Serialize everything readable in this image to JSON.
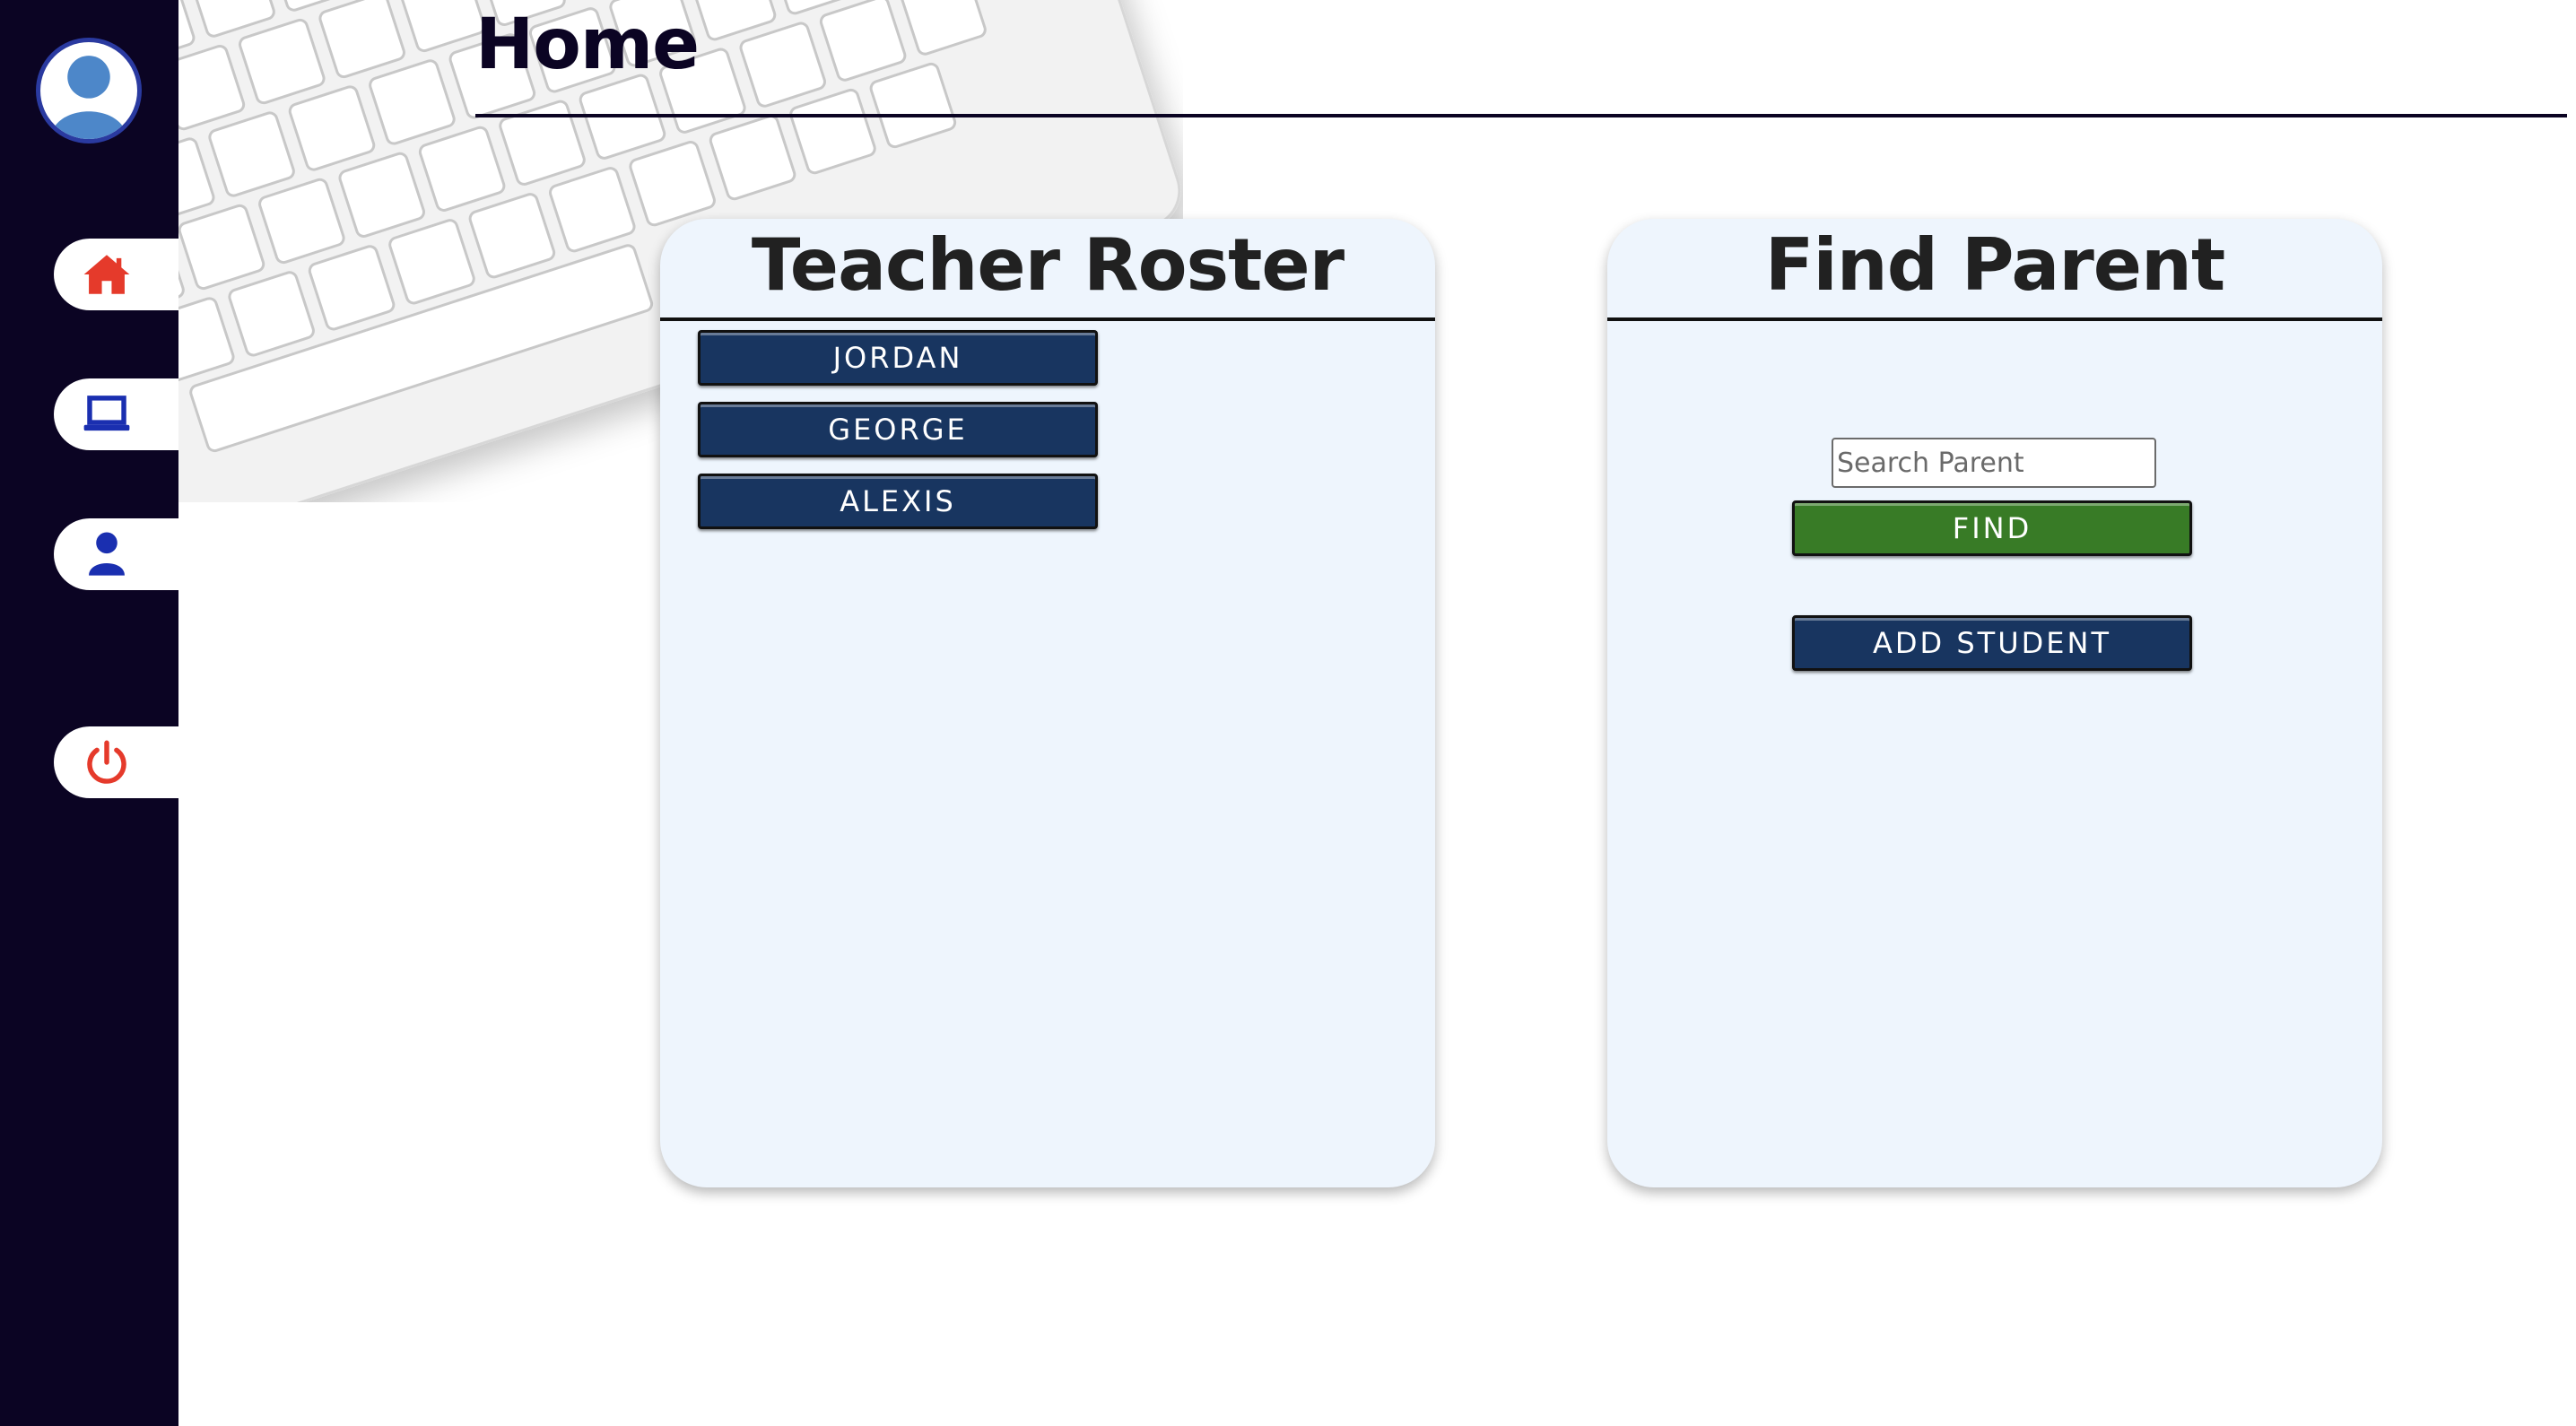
{
  "header": {
    "title": "Home"
  },
  "sidebar": {
    "items": [
      {
        "name": "home",
        "icon": "home-icon",
        "color": "#e53a2b"
      },
      {
        "name": "laptop",
        "icon": "laptop-icon",
        "color": "#1a2fb0"
      },
      {
        "name": "profile",
        "icon": "user-icon",
        "color": "#1a2fb0"
      },
      {
        "name": "logout",
        "icon": "power-icon",
        "color": "#e53a2b"
      }
    ]
  },
  "roster": {
    "title": "Teacher Roster",
    "teachers": [
      "JORDAN",
      "GEORGE",
      "ALEXIS"
    ]
  },
  "find_parent": {
    "title": "Find Parent",
    "search_placeholder": "Search Parent",
    "search_value": "",
    "find_label": "FIND",
    "add_student_label": "ADD STUDENT"
  },
  "colors": {
    "sidebar_bg": "#0b0423",
    "card_bg": "#eef5fd",
    "navy_button": "#183560",
    "green_button": "#387b26"
  }
}
